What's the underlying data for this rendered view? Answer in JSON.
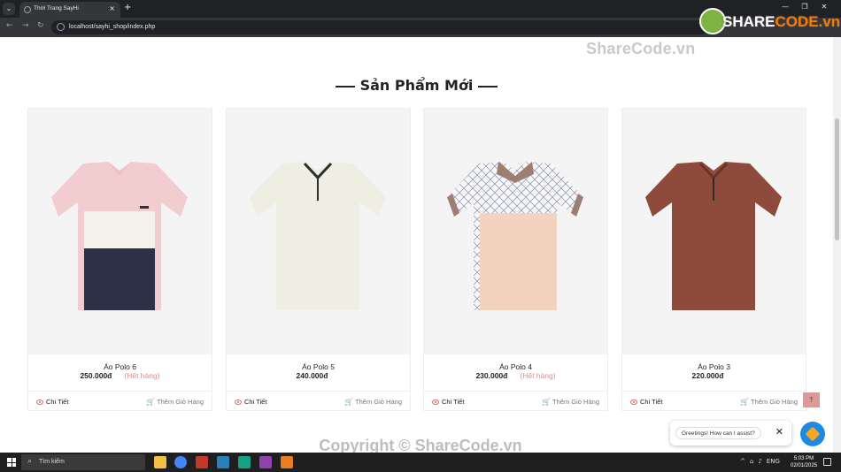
{
  "browser": {
    "tab_title": "Thời Trang SayHi",
    "tab_close": "×",
    "new_tab": "+",
    "url": "localhost/sayhi_shop/index.php",
    "window_controls": [
      "—",
      "❐",
      "✕"
    ]
  },
  "watermarks": {
    "top": "ShareCode.vn",
    "bottom": "Copyright © ShareCode.vn",
    "logo_prefix": "SHARE",
    "logo_suffix": "CODE.vn"
  },
  "section": {
    "title": "Sản Phẩm Mới"
  },
  "products": [
    {
      "name": "Áo Polo 6",
      "price": "250.000đ",
      "status": "(Hết hàng)",
      "detail_label": "Chi Tiết",
      "cart_label": "Thêm Giỏ Hàng",
      "colors": [
        "#f2cdd0",
        "#f4f1ea",
        "#2c3049"
      ]
    },
    {
      "name": "Áo Polo 5",
      "price": "240.000đ",
      "status": "",
      "detail_label": "Chi Tiết",
      "cart_label": "Thêm Giỏ Hàng",
      "colors": [
        "#efeee3"
      ]
    },
    {
      "name": "Áo Polo 4",
      "price": "230.000đ",
      "status": "(Hết hàng)",
      "detail_label": "Chi Tiết",
      "cart_label": "Thêm Giỏ Hàng",
      "colors": [
        "#f7f7f9",
        "#f3d2c0",
        "#9c7e72"
      ]
    },
    {
      "name": "Áo Polo 3",
      "price": "220.000đ",
      "status": "",
      "detail_label": "Chi Tiết",
      "cart_label": "Thêm Giỏ Hàng",
      "colors": [
        "#8e4a3a"
      ]
    }
  ],
  "chat": {
    "greeting": "Greetings! How can I assist?",
    "close": "✕"
  },
  "back_to_top": "⤒",
  "taskbar": {
    "search_placeholder": "Tìm kiếm",
    "tray_lang": "ENG",
    "time": "5:03 PM",
    "date": "02/01/2025"
  }
}
